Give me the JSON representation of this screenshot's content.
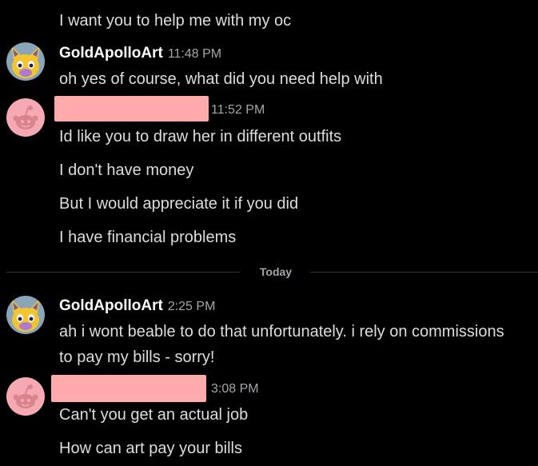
{
  "messages": {
    "m0": {
      "text": "I want you to help me with my oc"
    },
    "m1": {
      "author": "GoldApolloArt",
      "time": "11:48 PM",
      "lines": [
        "oh yes of course, what did you need help with"
      ]
    },
    "m2": {
      "time": "11:52 PM",
      "lines": [
        "Id like you to draw her in different outfits",
        "I don't have money",
        "But I would appreciate it if you did",
        "I have financial problems"
      ]
    },
    "divider": {
      "label": "Today"
    },
    "m3": {
      "author": "GoldApolloArt",
      "time": "2:25 PM",
      "lines": [
        "ah i wont beable to do that unfortunately. i rely on commissions",
        "to pay my bills - sorry!"
      ]
    },
    "m4": {
      "time": "3:08 PM",
      "lines": [
        "Can't you get an actual job",
        "How can art pay your bills"
      ]
    }
  },
  "colors": {
    "background": "#000000",
    "text": "#dcddde",
    "username": "#ffffff",
    "timestamp": "#a3a6aa",
    "redaction": "#ffaaab",
    "reddit_avatar_bg": "#f6a9b2"
  },
  "icons": {
    "artist_avatar": "yellow-cartoon-character-avatar",
    "user_avatar": "reddit-snoo-avatar"
  }
}
